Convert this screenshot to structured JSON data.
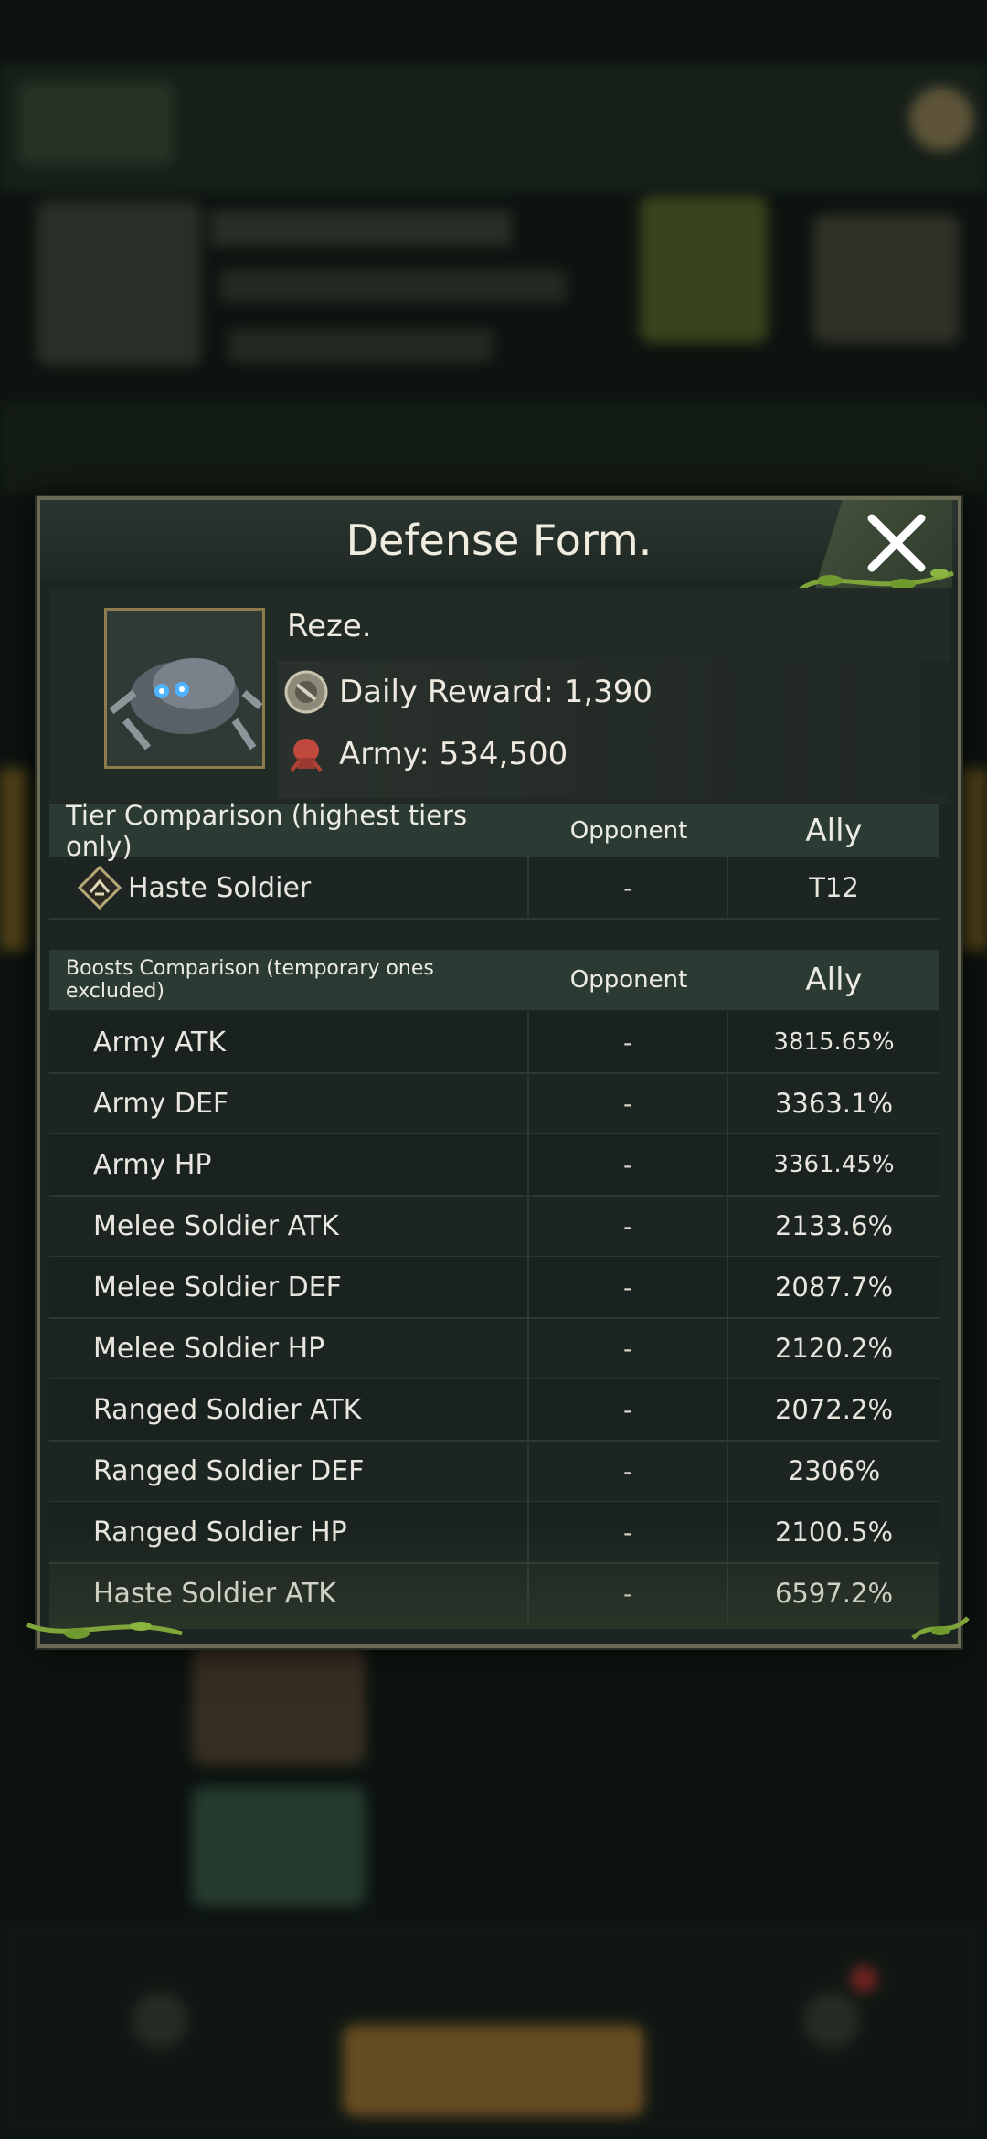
{
  "modal": {
    "title": "Defense Form.",
    "close_icon": "close-x-icon"
  },
  "profile": {
    "name": "Reze.",
    "daily_reward_label": "Daily Reward: 1,390",
    "army_label": "Army: 534,500"
  },
  "tier_table": {
    "header": {
      "label": "Tier Comparison (highest tiers only)",
      "opponent": "Opponent",
      "ally": "Ally"
    },
    "rows": [
      {
        "name": "Haste Soldier",
        "opponent": "-",
        "ally": "T12"
      }
    ]
  },
  "boosts_table": {
    "header": {
      "label": "Boosts Comparison (temporary ones excluded)",
      "opponent": "Opponent",
      "ally": "Ally"
    },
    "rows": [
      {
        "name": "Army ATK",
        "opponent": "-",
        "ally": "3815.65%"
      },
      {
        "name": "Army DEF",
        "opponent": "-",
        "ally": "3363.1%"
      },
      {
        "name": "Army HP",
        "opponent": "-",
        "ally": "3361.45%"
      },
      {
        "name": "Melee Soldier ATK",
        "opponent": "-",
        "ally": "2133.6%"
      },
      {
        "name": "Melee Soldier DEF",
        "opponent": "-",
        "ally": "2087.7%"
      },
      {
        "name": "Melee Soldier HP",
        "opponent": "-",
        "ally": "2120.2%"
      },
      {
        "name": "Ranged Soldier ATK",
        "opponent": "-",
        "ally": "2072.2%"
      },
      {
        "name": "Ranged Soldier DEF",
        "opponent": "-",
        "ally": "2306%"
      },
      {
        "name": "Ranged Soldier HP",
        "opponent": "-",
        "ally": "2100.5%"
      },
      {
        "name": "Haste Soldier ATK",
        "opponent": "-",
        "ally": "6597.2%"
      }
    ]
  },
  "colors": {
    "panel": "#1d2522",
    "header_row": "#2c3a34",
    "frame": "#6b6a55",
    "vine": "#7fa43a"
  }
}
